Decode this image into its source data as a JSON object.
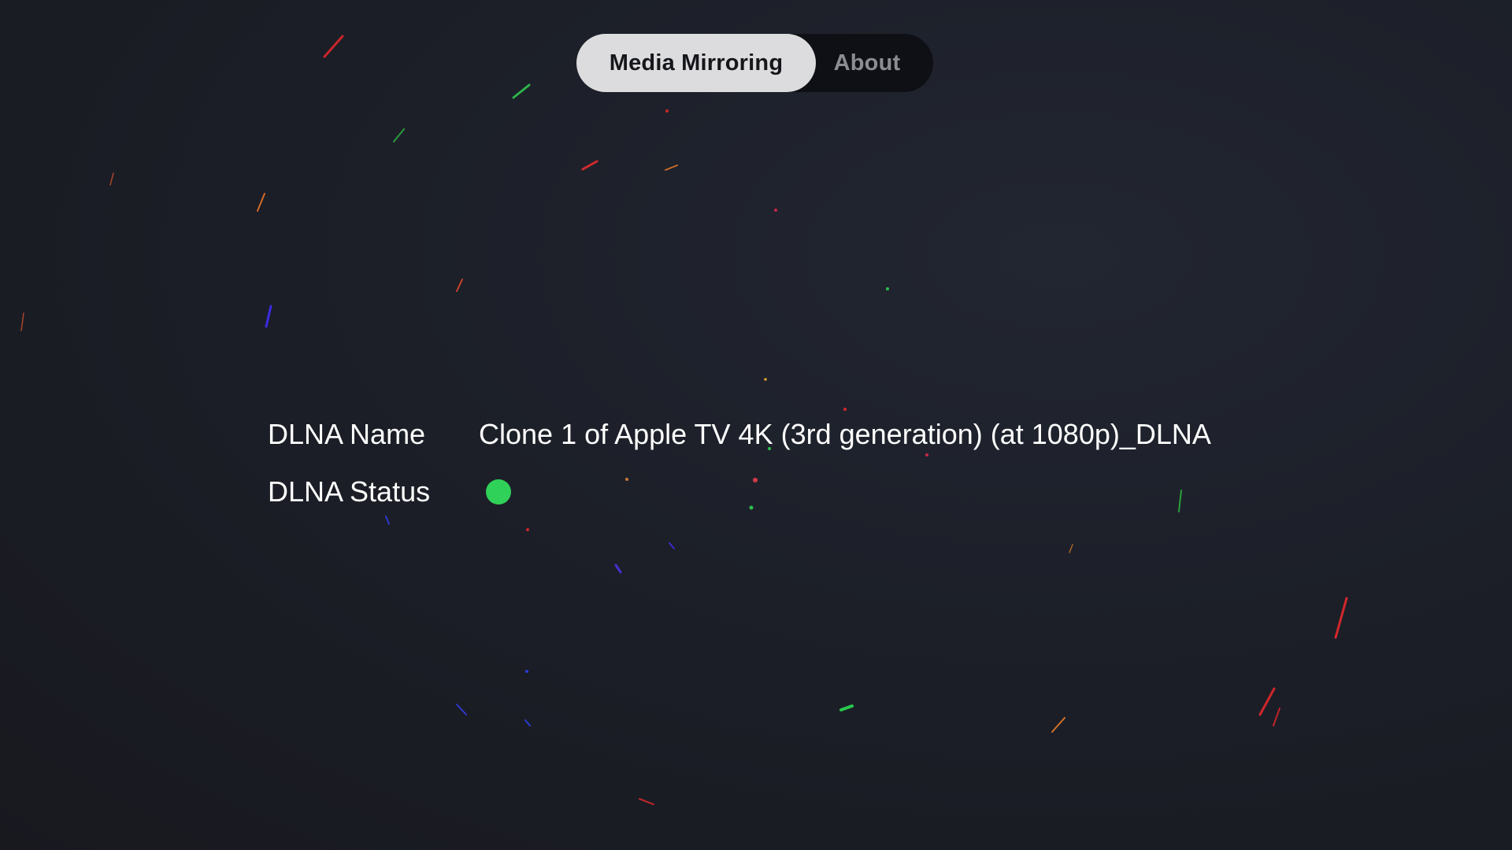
{
  "tabs": [
    {
      "label": "Media Mirroring",
      "active": true
    },
    {
      "label": "About",
      "active": false
    }
  ],
  "dlna": {
    "name_label": "DLNA Name",
    "name_value": "Clone 1 of Apple TV 4K (3rd generation) (at 1080p)_DLNA",
    "status_label": "DLNA Status",
    "status_indicator": "online",
    "status_color": "#30d158"
  },
  "background": {
    "style": "dark space with colored particle streaks",
    "base_color": "#1c1f28"
  }
}
